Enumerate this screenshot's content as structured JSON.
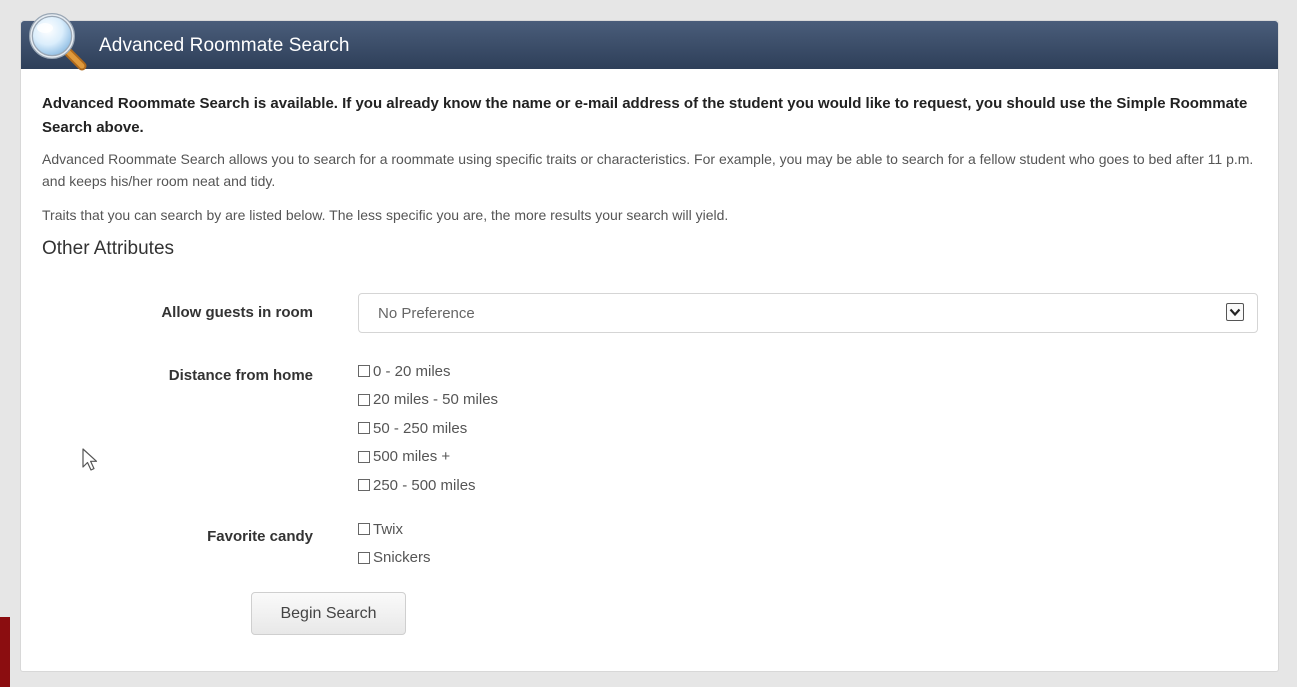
{
  "panel": {
    "title": "Advanced Roommate Search",
    "header_color": "#34465f"
  },
  "intro": {
    "bold_text": "Advanced Roommate Search is available. If you already know the name or e-mail address of the student you would like to request, you should use the Simple Roommate Search above.",
    "paragraph_1": "Advanced Roommate Search allows you to search for a roommate using specific traits or characteristics. For example, you may be able to search for a fellow student who goes to bed after 11 p.m. and keeps his/her room neat and tidy.",
    "paragraph_2": "Traits that you can search by are listed below. The less specific you are, the more results your search will yield."
  },
  "section": {
    "title": "Other Attributes"
  },
  "fields": {
    "guests": {
      "label": "Allow guests in room",
      "value": "No Preference"
    },
    "distance": {
      "label": "Distance from home",
      "options": [
        "0 - 20 miles",
        "20 miles - 50 miles",
        "50 - 250 miles",
        "500 miles +",
        "250 - 500 miles"
      ]
    },
    "candy": {
      "label": "Favorite candy",
      "options": [
        "Twix",
        "Snickers"
      ]
    }
  },
  "actions": {
    "begin_search_label": "Begin Search"
  },
  "icons": {
    "header_icon": "magnifier-icon",
    "cursor": "mouse-pointer-icon",
    "dropdown": "chevron-down-icon"
  }
}
